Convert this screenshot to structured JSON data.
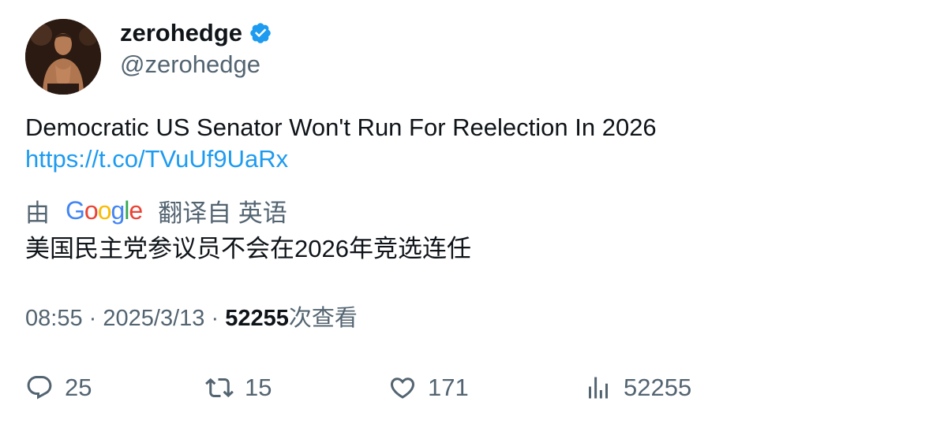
{
  "author": {
    "display_name": "zerohedge",
    "handle": "@zerohedge",
    "verified_icon": "verified-badge-icon",
    "verified_color": "#1d9bf0"
  },
  "tweet": {
    "text": "Democratic US Senator Won't Run For Reelection In 2026",
    "link": "https://t.co/TVuUf9UaRx",
    "link_color": "#1d9bf0"
  },
  "translation": {
    "prefix": "由",
    "provider": "Google",
    "suffix": "翻译自 英语",
    "text": "美国民主党参议员不会在2026年竞选连任"
  },
  "meta": {
    "time": "08:55",
    "date": "2025/3/13",
    "separator": "·",
    "views": "52255",
    "views_label": "次查看"
  },
  "actions": {
    "replies": "25",
    "retweets": "15",
    "likes": "171",
    "views": "52255"
  },
  "colors": {
    "text_primary": "#0f1419",
    "text_secondary": "#536471"
  }
}
